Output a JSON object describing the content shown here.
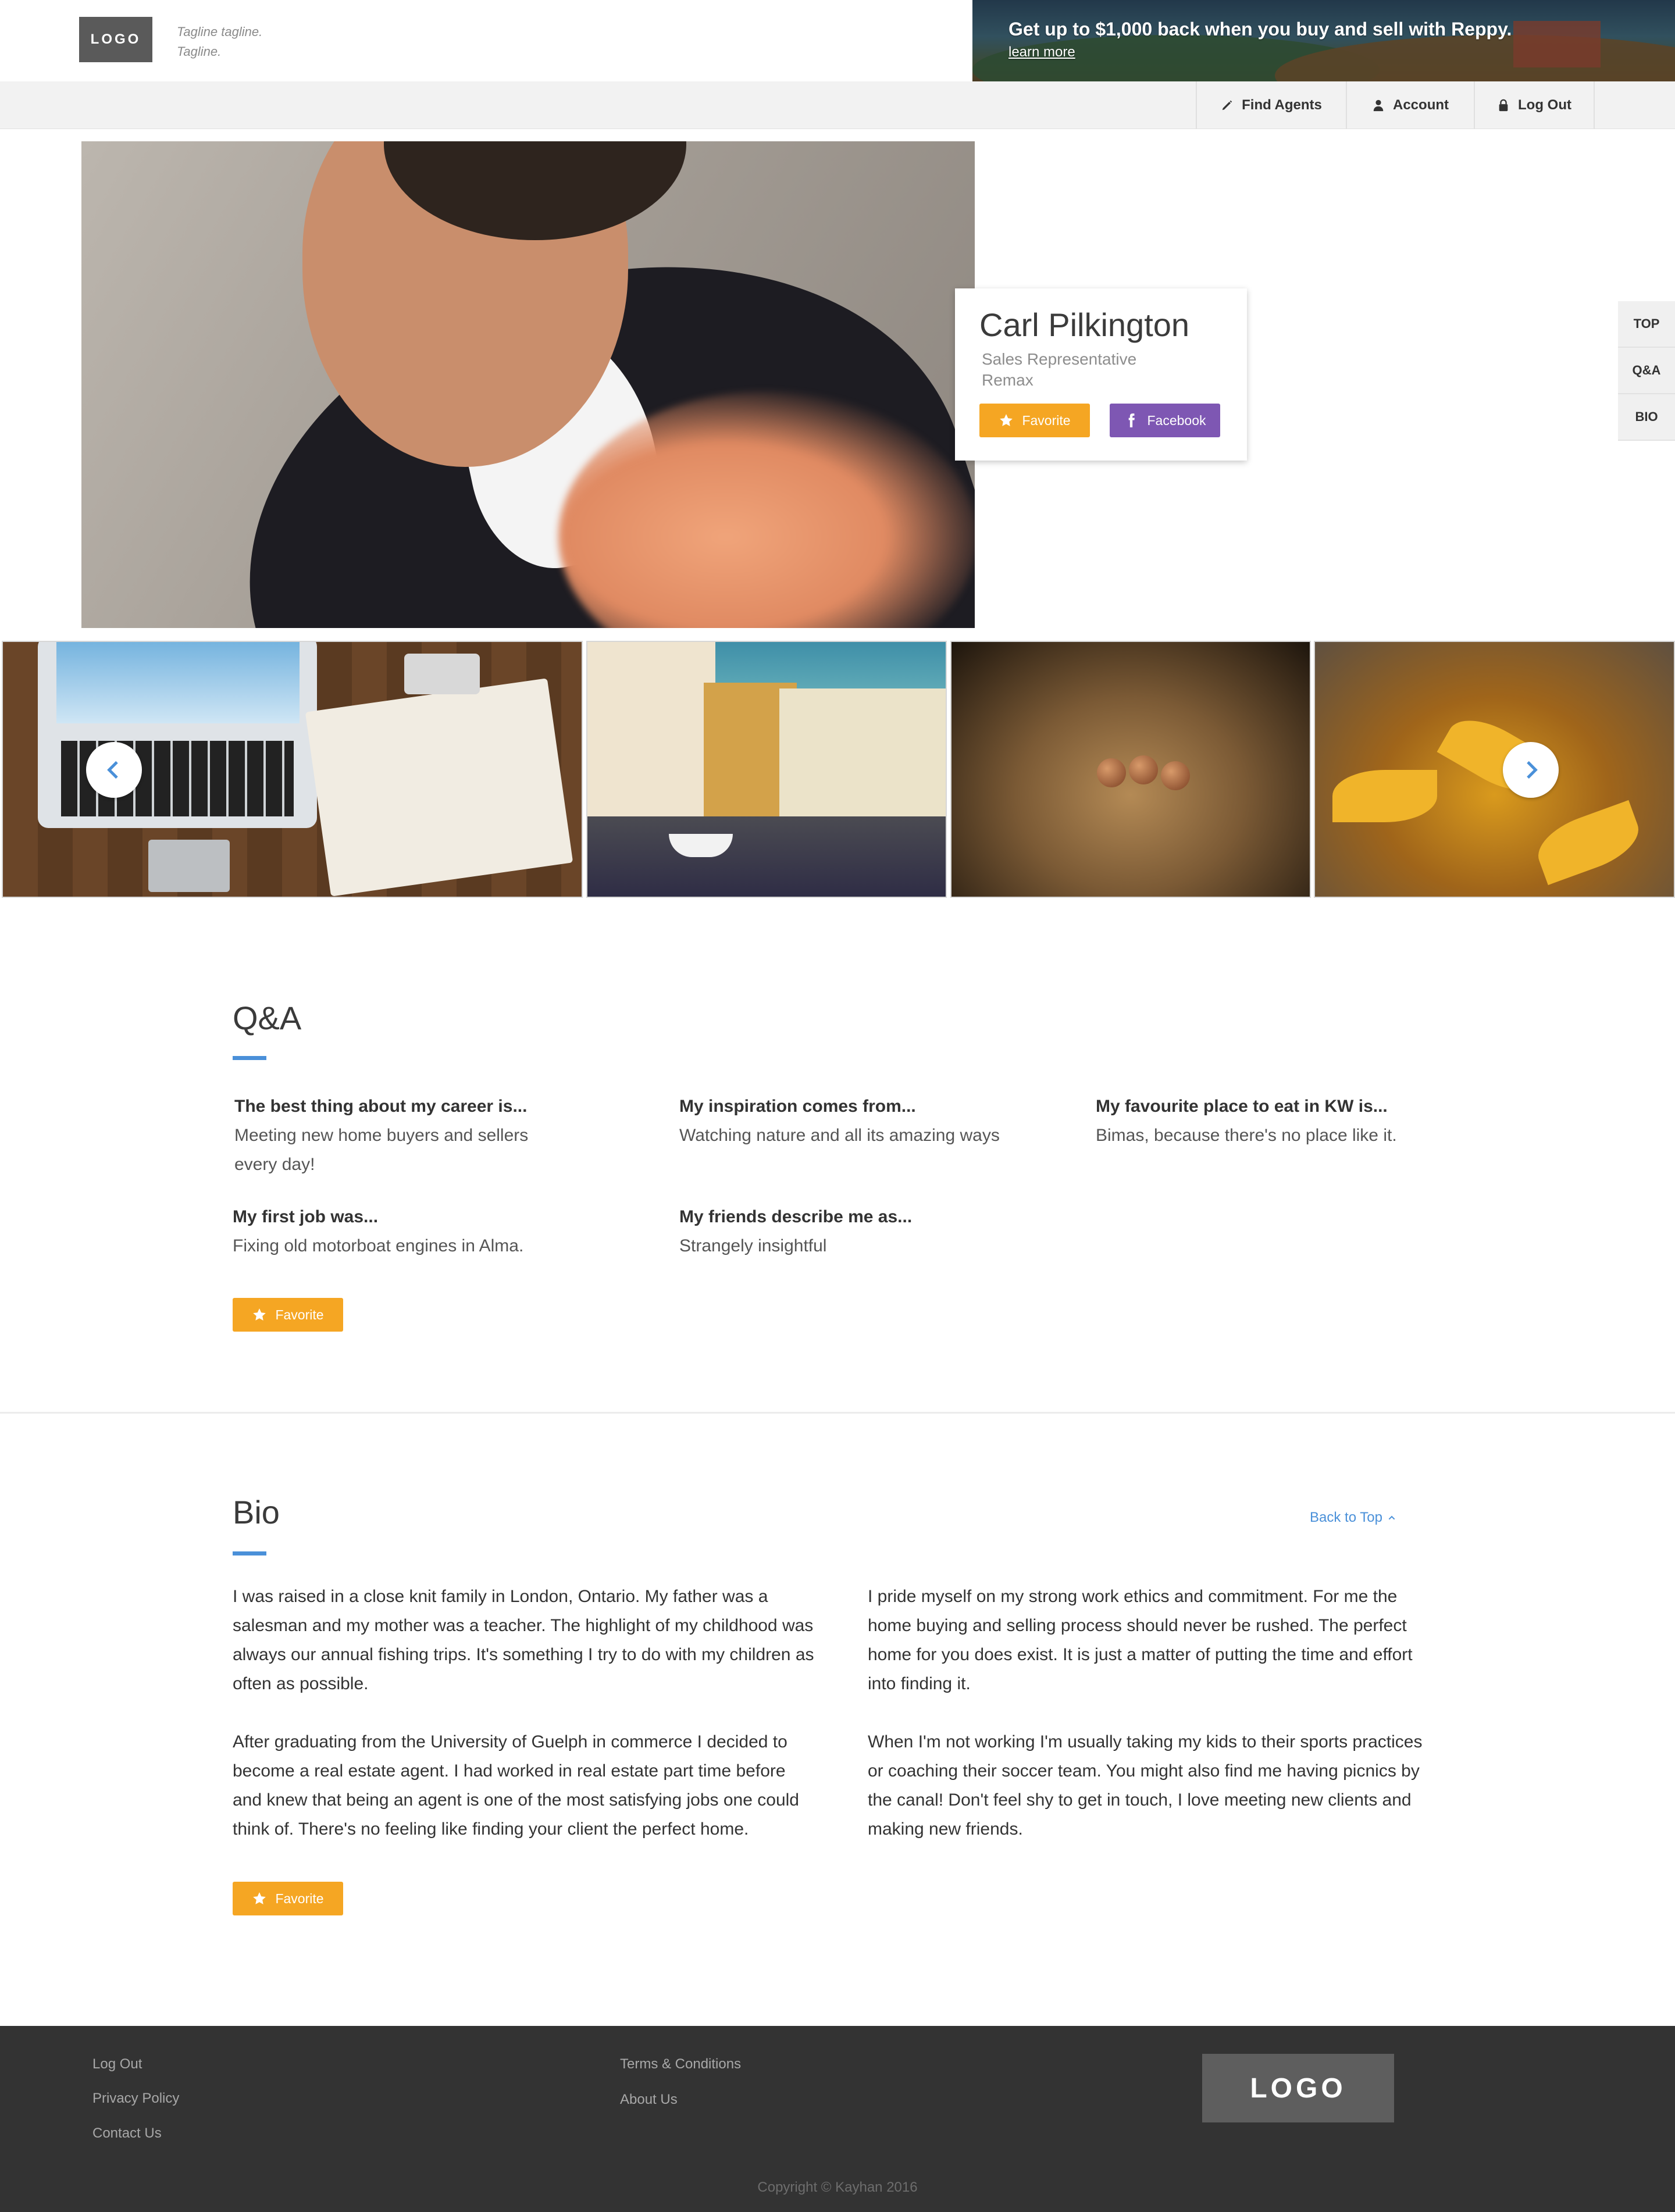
{
  "header": {
    "logo_text": "LOGO",
    "tagline_line1": "Tagline tagline.",
    "tagline_line2": "Tagline.",
    "promo": {
      "title": "Get up to $1,000 back when you buy and sell with Reppy.",
      "link": "learn more"
    }
  },
  "nav": {
    "items": [
      {
        "label": "Find Agents",
        "icon": "pencil-icon"
      },
      {
        "label": "Account",
        "icon": "user-icon"
      },
      {
        "label": "Log Out",
        "icon": "lock-icon"
      }
    ]
  },
  "profile": {
    "name": "Carl Pilkington",
    "title": "Sales Representative",
    "company": "Remax",
    "favorite_label": "Favorite",
    "facebook_label": "Facebook"
  },
  "section_nav": {
    "items": [
      "TOP",
      "Q&A",
      "BIO"
    ]
  },
  "gallery": {
    "images": [
      "laptop-notebook-desk",
      "canal-town-boats",
      "nuts-on-wood",
      "autumn-leaves"
    ],
    "prev_icon": "chevron-left-icon",
    "next_icon": "chevron-right-icon"
  },
  "qa": {
    "title": "Q&A",
    "items": [
      {
        "question": "The best thing about my career is...",
        "answer": "Meeting new home buyers and sellers every day!"
      },
      {
        "question": "My inspiration comes from...",
        "answer": "Watching nature and all its amazing ways"
      },
      {
        "question": "My favourite place to eat in KW is...",
        "answer": "Bimas, because there's no place like it."
      },
      {
        "question": "My first job was...",
        "answer": "Fixing old motorboat engines in Alma."
      },
      {
        "question": "My friends describe me as...",
        "answer": "Strangely insightful"
      }
    ],
    "favorite_label": "Favorite"
  },
  "bio": {
    "title": "Bio",
    "back_to_top": "Back to Top",
    "paragraphs": [
      "I was raised in a close knit family in London, Ontario. My father was a salesman and my mother was a teacher. The highlight of my childhood was always our annual fishing trips. It's something I try to do with my children as often as possible.",
      "After graduating from the University of Guelph in commerce I decided to become a real estate agent. I had worked in real estate part time before and knew that being an agent is one of the most satisfying jobs one could think of. There's no feeling like finding your client the perfect home.",
      "I pride myself on my strong work ethics and commitment. For me the home buying and selling process should never be rushed. The perfect home for you does exist. It is just a matter of putting the time and effort into finding it.",
      "When I'm not working I'm usually taking my kids to their sports practices or coaching their soccer team. You might also find me having picnics by the canal! Don't feel shy to get in touch, I love meeting new clients and making new friends."
    ],
    "favorite_label": "Favorite"
  },
  "footer": {
    "links_col1": [
      "Log Out",
      "Privacy Policy",
      "Contact Us"
    ],
    "links_col2": [
      "Terms & Conditions",
      "About Us"
    ],
    "logo_text": "LOGO",
    "copyright": "Copyright © Kayhan 2016"
  },
  "colors": {
    "accent_blue": "#4a90d9",
    "favorite_orange": "#f5a623",
    "facebook_purple": "#7e57b3",
    "footer_bg": "#333333"
  }
}
